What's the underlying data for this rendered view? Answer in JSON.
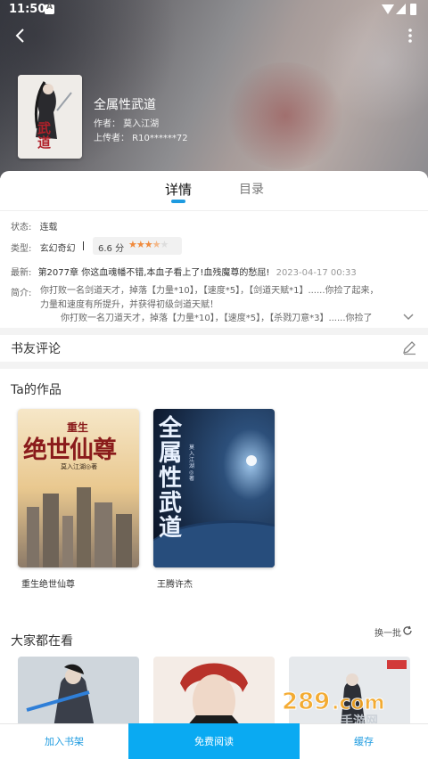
{
  "status_bar": {
    "time": "11:50"
  },
  "book": {
    "title": "全属性武道",
    "author": "作者：  莫入江湖",
    "uploader": "上传者：  R10******72",
    "cover_text": "武道"
  },
  "tabs": [
    {
      "label": "详情",
      "active": true
    },
    {
      "label": "目录",
      "active": false
    }
  ],
  "details": {
    "status_label": "状态:",
    "status_value": "连载",
    "type_label": "类型:",
    "type_value": "玄幻奇幻",
    "rating_score": "6.6 分",
    "rating_stars": 3.5,
    "latest_label": "最新:",
    "latest_chapter": "第2077章 你这血魂幡不错,本血子看上了!血残魔尊的愁屈!",
    "latest_time": "2023-04-17 00:33",
    "intro_label": "简介:",
    "intro_lines": [
      "你打败一名剑道天才，掉落【力量*10】，【速度*5】，【剑道天赋*1】......你捡了起来，",
      "力量和速度有所提升，并获得初级剑道天赋！",
      "你打败一名刀道天才，掉落【力量*10】，【速度*5】，【杀戮刀意*3】......你捡了"
    ]
  },
  "comments": {
    "title": "书友评论"
  },
  "works": {
    "title": "Ta的作品",
    "items": [
      {
        "name": "重生绝世仙尊",
        "cover_title": "绝世仙尊",
        "cover_top": "重生",
        "cover_author": "莫入江湖◎著"
      },
      {
        "name": "王腾许杰",
        "cover_title": "全属性武道",
        "cover_author": "莫入江湖◎著"
      }
    ]
  },
  "popular": {
    "title": "大家都在看",
    "refresh_label": "换一批"
  },
  "bottom_bar": {
    "add_shelf": "加入书架",
    "free_read": "免费阅读",
    "cache": "缓存"
  },
  "watermark": {
    "text": "289.com",
    "sub": "手游网"
  },
  "colors": {
    "accent": "#1e9be0",
    "read_button": "#0aaaf2",
    "star": "#f08a3c"
  }
}
